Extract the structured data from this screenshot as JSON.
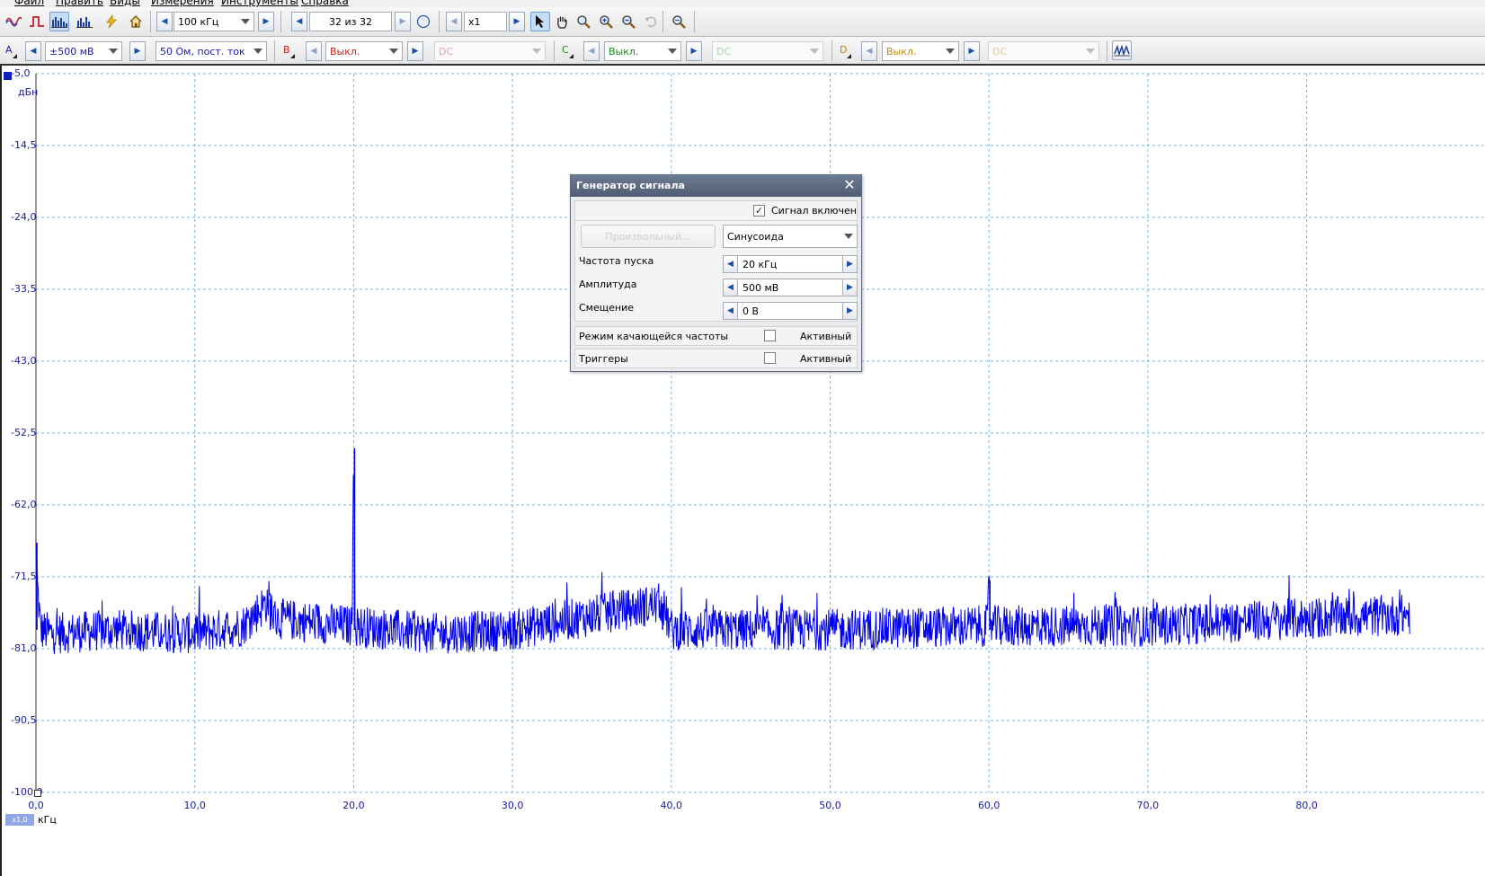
{
  "menu": {
    "items": [
      "Файл",
      "Править",
      "Виды",
      "Измерения",
      "Инструменты",
      "Справка"
    ]
  },
  "toolbar": {
    "mode_icons": [
      "scope-mode-icon",
      "persistence-mode-icon",
      "spectrum-mode-icon",
      "spectrum-persistence-icon",
      "auto-setup-icon",
      "home-icon"
    ],
    "timebase": "100 кГц",
    "capture_counter": "32 из 32",
    "zoom_factor": "x1",
    "tool_icons": [
      "pointer-icon",
      "hand-icon",
      "zoom-region-icon",
      "zoom-in-icon",
      "zoom-out-icon",
      "undo-zoom-icon",
      "zoom-fit-icon"
    ]
  },
  "channels": {
    "a": {
      "label": "A",
      "range": "±500 мВ",
      "coupling": "50 Ом, пост. ток",
      "color": "#1a1aa6"
    },
    "b": {
      "label": "B",
      "range": "Выкл.",
      "coupling": "DC",
      "color": "#d02020"
    },
    "c": {
      "label": "C",
      "range": "Выкл.",
      "coupling": "DC",
      "color": "#1f8a1f"
    },
    "d": {
      "label": "D",
      "range": "Выкл.",
      "coupling": "DC",
      "color": "#c08a00"
    }
  },
  "plot": {
    "y_unit": "дБн",
    "x_unit": "кГц",
    "x_zoom_tag": "x1,0",
    "trace_color": "#0000ee",
    "grid_color": "#7ab6e0"
  },
  "chart_data": {
    "type": "line",
    "title": "",
    "xlabel": "кГц",
    "ylabel": "дБн",
    "xlim": [
      0.0,
      86.5
    ],
    "ylim": [
      -100.0,
      -5.0
    ],
    "x_ticks": [
      "0,0",
      "10,0",
      "20,0",
      "30,0",
      "40,0",
      "50,0",
      "60,0",
      "70,0",
      "80,0"
    ],
    "y_ticks": [
      "-5,0",
      "-14,5",
      "-24,0",
      "-33,5",
      "-43,0",
      "-52,5",
      "-62,0",
      "-71,5",
      "-81,0",
      "-90,5",
      "-100,0"
    ],
    "grid": true,
    "noise_floor_db": -78.5,
    "series": [
      {
        "x": [
          0.0,
          0.1,
          0.3,
          1.0,
          5.0,
          10.0,
          13.0,
          14.7,
          15.0,
          19.9,
          20.0,
          20.1,
          25.0,
          30.0,
          39.4,
          40.0,
          50.0,
          59.9,
          60.0,
          60.1,
          70.0,
          80.0,
          86.5
        ],
        "y": [
          -67.0,
          -73.0,
          -78.5,
          -79.0,
          -78.5,
          -79.0,
          -78.0,
          -74.5,
          -77.0,
          -78.0,
          -54.5,
          -78.0,
          -79.0,
          -78.5,
          -75.0,
          -78.5,
          -78.5,
          -78.0,
          -72.0,
          -78.0,
          -78.0,
          -77.0,
          -76.5
        ]
      }
    ]
  },
  "dialog": {
    "title": "Генератор сигнала",
    "signal_enabled_label": "Сигнал включен",
    "signal_enabled": true,
    "arbitrary_button": "Произвольный...",
    "waveform": "Синусоида",
    "start_freq_label": "Частота пуска",
    "start_freq_value": "20 кГц",
    "amplitude_label": "Амплитуда",
    "amplitude_value": "500 мВ",
    "offset_label": "Смещение",
    "offset_value": "0 В",
    "sweep_label": "Режим качающейся частоты",
    "sweep_active_label": "Активный",
    "triggers_label": "Триггеры",
    "triggers_active_label": "Активный"
  }
}
